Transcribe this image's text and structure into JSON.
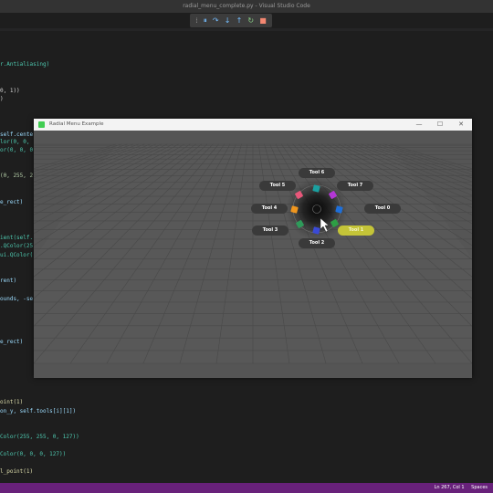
{
  "window": {
    "title": "radial_menu_complete.py - Visual Studio Code"
  },
  "colors": {
    "accent": "#68217a",
    "highlight": "#c4c438",
    "canvas_bg": "#555555",
    "pill_bg": "#3a3a3a"
  },
  "debug_toolbar": [
    {
      "name": "grip",
      "icon": "grip-icon",
      "glyph": "⁞",
      "color": "#8a8a8a"
    },
    {
      "name": "pause",
      "icon": "pause-icon",
      "glyph": "⏸",
      "color": "#75beff"
    },
    {
      "name": "step-over",
      "icon": "step-over-icon",
      "glyph": "↷",
      "color": "#75beff"
    },
    {
      "name": "step-into",
      "icon": "step-into-icon",
      "glyph": "↓",
      "color": "#75beff"
    },
    {
      "name": "step-out",
      "icon": "step-out-icon",
      "glyph": "↑",
      "color": "#75beff"
    },
    {
      "name": "restart",
      "icon": "restart-icon",
      "glyph": "↻",
      "color": "#89d185"
    },
    {
      "name": "stop",
      "icon": "stop-icon",
      "glyph": "■",
      "color": "#f48771"
    }
  ],
  "code_lines": [
    {
      "text": "r.Antialiasing)",
      "color": "#4ec9b0"
    },
    {
      "text": "0, 1))",
      "color": "#d4d4d4"
    },
    {
      "text": ")",
      "color": "#d4d4d4"
    },
    {
      "text": "self.cente",
      "color": "#9cdcfe"
    },
    {
      "text": "lor(0, 0,",
      "color": "#4ec9b0"
    },
    {
      "text": "or(0, 0, 0",
      "color": "#4ec9b0"
    },
    {
      "text": "(0, 255, 2",
      "color": "#b5cea8"
    },
    {
      "text": "e_rect)",
      "color": "#9cdcfe"
    },
    {
      "text": "ient(self.",
      "color": "#4ec9b0"
    },
    {
      "text": ".QColor(25",
      "color": "#4ec9b0"
    },
    {
      "text": "ui.QColor(",
      "color": "#4ec9b0"
    },
    {
      "text": "rent)",
      "color": "#9cdcfe"
    },
    {
      "text": "ounds, -se",
      "color": "#9cdcfe"
    },
    {
      "text": "e_rect)",
      "color": "#9cdcfe"
    },
    {
      "text": "oint(1)",
      "color": "#dcdcaa"
    },
    {
      "text": "on_y, self.tools[i][1])",
      "color": "#9cdcfe"
    },
    {
      "text": "Color(255, 255, 0, 127))",
      "color": "#4ec9b0"
    },
    {
      "text": "Color(0, 0, 0, 127))",
      "color": "#4ec9b0"
    },
    {
      "text": "l_point(1)",
      "color": "#dcdcaa"
    }
  ],
  "app_window": {
    "title": "Radial Menu Example",
    "minimize": "—",
    "maximize": "☐",
    "close": "✕"
  },
  "radial_menu": {
    "tools": [
      {
        "label": "Tool 0",
        "color": "#1e6fd9",
        "highlighted": false
      },
      {
        "label": "Tool 1",
        "color": "#2e9e44",
        "highlighted": true
      },
      {
        "label": "Tool 2",
        "color": "#3a4ad6",
        "highlighted": false
      },
      {
        "label": "Tool 3",
        "color": "#2e9a5a",
        "highlighted": false
      },
      {
        "label": "Tool 4",
        "color": "#f0961e",
        "highlighted": false
      },
      {
        "label": "Tool 5",
        "color": "#e8577a",
        "highlighted": false
      },
      {
        "label": "Tool 6",
        "color": "#1aa0a0",
        "highlighted": false
      },
      {
        "label": "Tool 7",
        "color": "#b437d6",
        "highlighted": false
      }
    ]
  },
  "status_bar": {
    "position": "Ln 267, Col 1",
    "indent": "Spaces"
  }
}
